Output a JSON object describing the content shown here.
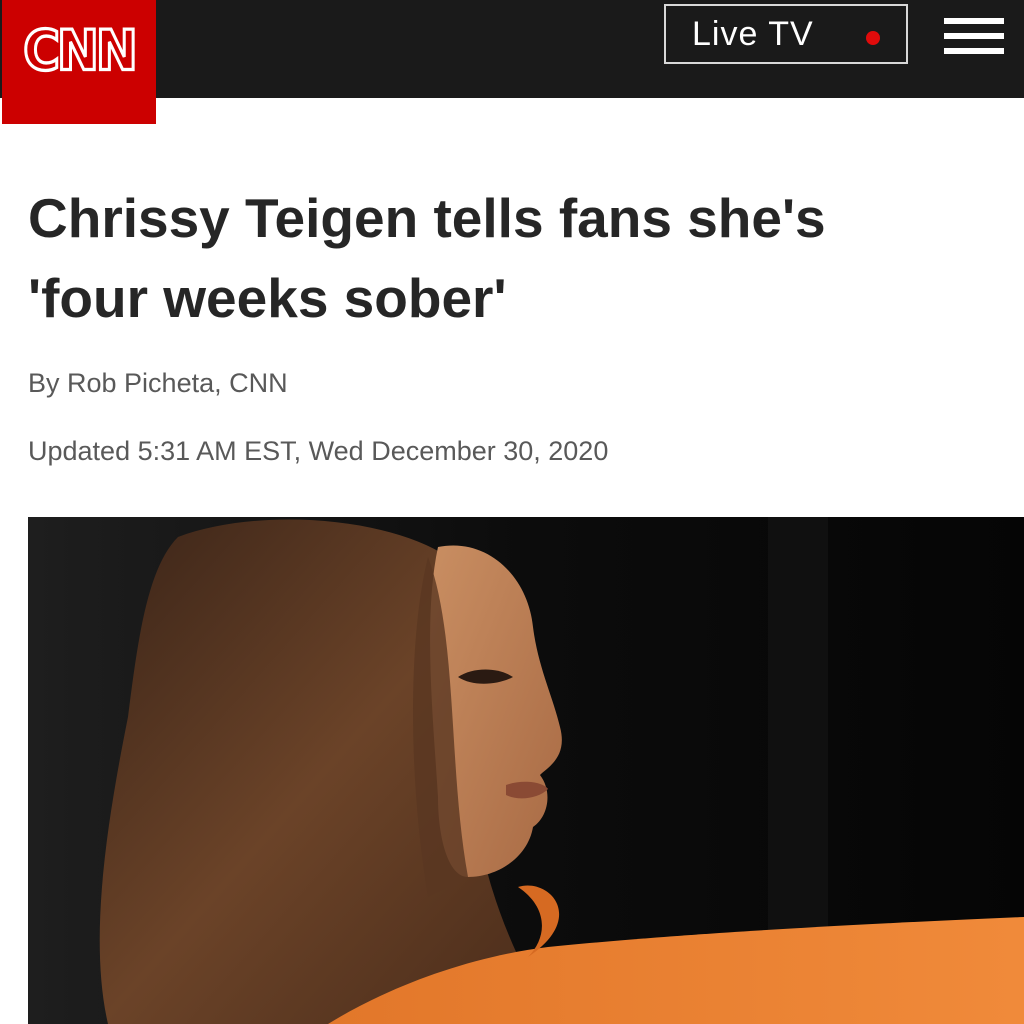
{
  "header": {
    "logo": "CNN",
    "live_tv_label": "Live TV",
    "live_indicator_color": "#e00b0b",
    "menu_icon": "hamburger-menu-icon",
    "brand_color": "#cc0000",
    "bar_color": "#1a1a1a"
  },
  "article": {
    "headline_line1": "Chrissy Teigen tells fans she's",
    "headline_line2": "'four weeks sober'",
    "byline": "By Rob Picheta, CNN",
    "updated": "Updated 5:31 AM EST, Wed December 30, 2020"
  }
}
